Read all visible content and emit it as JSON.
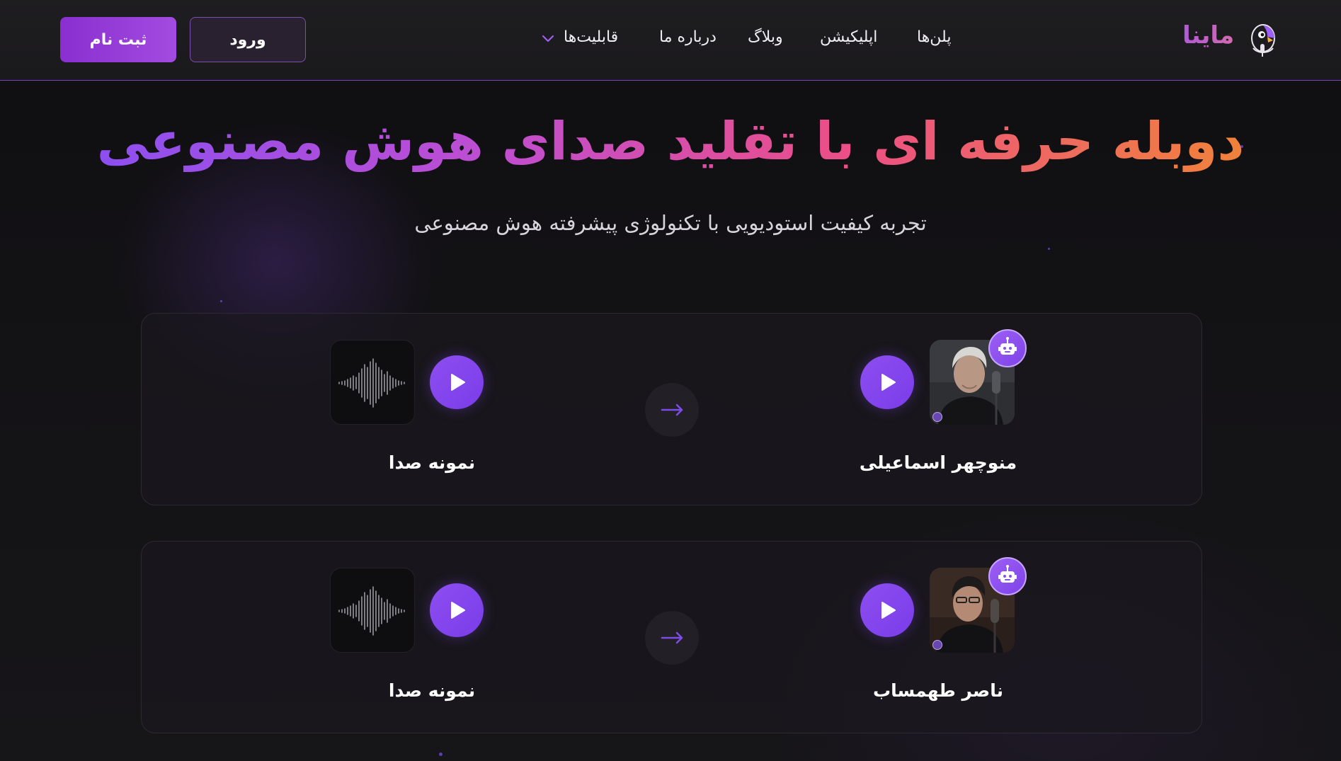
{
  "header": {
    "signup_label": "ثبت نام",
    "login_label": "ورود",
    "nav": {
      "features": "قابلیت‌ها",
      "about": "درباره ما",
      "blog": "وبلاگ",
      "app": "اپلیکیشن",
      "plans": "پلن‌ها"
    },
    "brand": "ماینا"
  },
  "hero": {
    "title": "دوبله حرفه ای با تقلید صدای هوش مصنوعی",
    "subtitle": "تجربه کیفیت استودیویی با تکنولوژی پیشرفته هوش مصنوعی"
  },
  "cards": [
    {
      "sample_label": "نمونه صدا",
      "voice_name": "منوچهر اسماعیلی"
    },
    {
      "sample_label": "نمونه صدا",
      "voice_name": "ناصر طهمساب"
    }
  ],
  "icons": {
    "play": "play-icon",
    "arrow": "arrow-right-icon",
    "waveform": "waveform-icon",
    "robot": "robot-icon"
  },
  "colors": {
    "accent": "#8d4ff0",
    "gradient_start": "#8d4ff0",
    "gradient_end": "#f0823a",
    "background": "#131214"
  }
}
